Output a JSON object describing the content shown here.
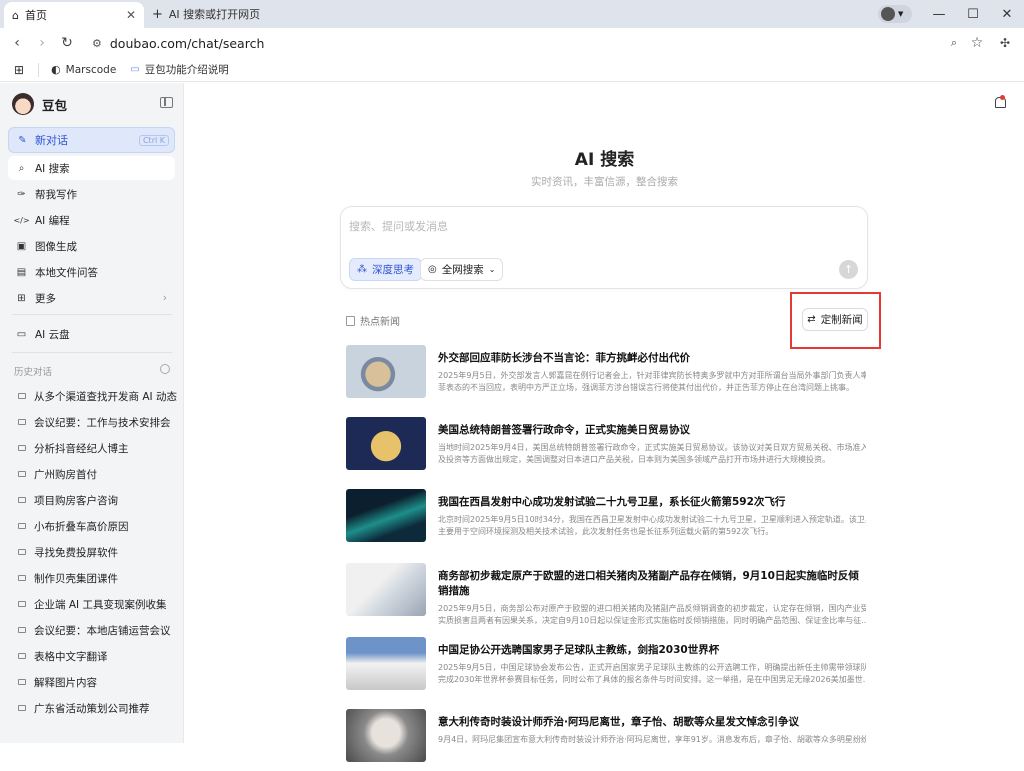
{
  "browser": {
    "active_tab": "首页",
    "new_tab": "AI 搜索或打开网页",
    "url": "doubao.com/chat/search",
    "bookmarks": [
      "Marscode",
      "豆包功能介绍说明"
    ]
  },
  "sidebar": {
    "brand": "豆包",
    "new_chat": "新对话",
    "new_chat_shortcut": "Ctrl K",
    "nav": [
      {
        "label": "AI 搜索",
        "icon": "search-icon"
      },
      {
        "label": "帮我写作",
        "icon": "pen-icon"
      },
      {
        "label": "AI 编程",
        "icon": "code-icon"
      },
      {
        "label": "图像生成",
        "icon": "image-icon"
      },
      {
        "label": "本地文件问答",
        "icon": "file-icon"
      },
      {
        "label": "更多",
        "icon": "grid-icon"
      }
    ],
    "cloud": "AI 云盘",
    "history_header": "历史对话",
    "history": [
      "从多个渠道查找开发商 AI 动态",
      "会议纪要：工作与技术安排会",
      "分析抖音经纪人博主",
      "广州购房首付",
      "项目购房客户咨询",
      "小布折叠车高价原因",
      "寻找免费投屏软件",
      "制作贝壳集团课件",
      "企业端 AI 工具变现案例收集",
      "会议纪要：本地店铺运营会议",
      "表格中文字翻译",
      "解释图片内容",
      "广东省活动策划公司推荐"
    ]
  },
  "main": {
    "title": "AI 搜索",
    "subtitle": "实时资讯，丰富信源，整合搜索",
    "input_placeholder": "搜索、提问或发消息",
    "deep_think": "深度思考",
    "web_search": "全网搜索",
    "hot_news": "热点新闻",
    "customize": "定制新闻",
    "news": [
      {
        "title": "外交部回应菲防长涉台不当言论：菲方挑衅必付出代价",
        "desc": [
          "2025年9月5日，外交部发言人郭嘉昆在例行记者会上，针对菲律宾防长特奥多罗就中方对菲所谓台当局外事部门负责人率",
          "菲表态的不当回应，表明中方严正立场，强调菲方涉台错误言行将使其付出代价，并正告菲方停止在台湾问题上挑事。"
        ]
      },
      {
        "title": "美国总统特朗普签署行政命令，正式实施美日贸易协议",
        "desc": [
          "当地时间2025年9月4日，美国总统特朗普签署行政命令，正式实施美日贸易协议。该协议对美日双方贸易关税、市场准入",
          "及投资等方面做出规定，美国调整对日本进口产品关税，日本则为美国多领域产品打开市场并进行大规模投资。"
        ]
      },
      {
        "title": "我国在西昌发射中心成功发射试验二十九号卫星，系长征火箭第592次飞行",
        "desc": [
          "北京时间2025年9月5日10时34分，我国在西昌卫星发射中心成功发射试验二十九号卫星，卫星顺利进入预定轨道。该卫星",
          "主要用于空间环境探测及相关技术试验，此次发射任务也是长征系列运载火箭的第592次飞行。"
        ]
      },
      {
        "title": "商务部初步裁定原产于欧盟的进口相关猪肉及猪副产品存在倾销，9月10日起实施临时反倾销措施",
        "desc": [
          "2025年9月5日，商务部公布对原产于欧盟的进口相关猪肉及猪副产品反倾销调查的初步裁定，认定存在倾销，国内产业受",
          "实质损害且两者有因果关系，决定自9月10日起以保证金形式实施临时反倾销措施，同时明确产品范围、保证金比率与征..."
        ]
      },
      {
        "title": "中国足协公开选聘国家男子足球队主教练，剑指2030世界杯",
        "desc": [
          "2025年9月5日，中国足球协会发布公告，正式开启国家男子足球队主教练的公开选聘工作，明确提出新任主帅需带领球队",
          "完成2030年世界杯参赛目标任务，同时公布了具体的报名条件与时间安排。这一举措，是在中国男足无缘2026美加墨世..."
        ]
      },
      {
        "title": "意大利传奇时装设计师乔治·阿玛尼离世，章子怡、胡歌等众星发文悼念引争议",
        "desc": [
          "9月4日，阿玛尼集团宣布意大利传奇时装设计师乔治·阿玛尼离世，享年91岁。消息发布后，章子怡、胡歌等众多明星纷纷发文",
          ""
        ]
      }
    ]
  }
}
